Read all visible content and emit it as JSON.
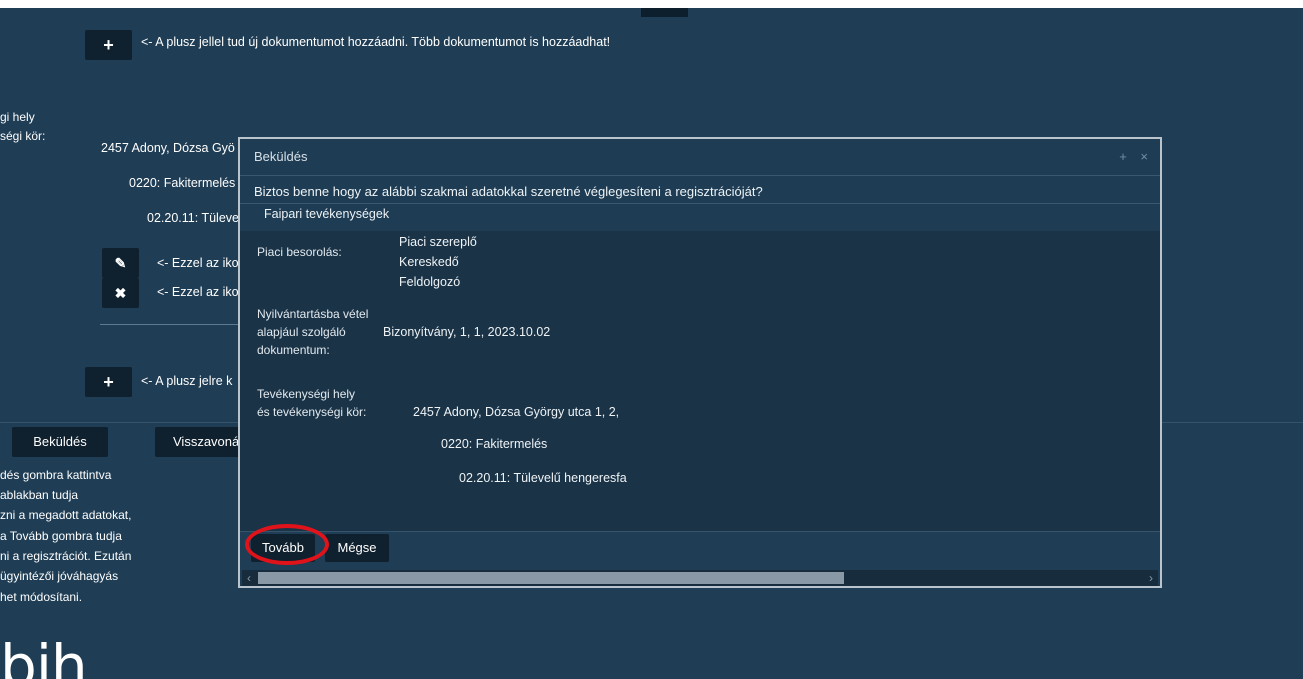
{
  "bg": {
    "add_doc_hint": "<- A plusz jellel tud új dokumentumot hozzáadni. Több dokumentumot is hozzáadhat!",
    "side_label_1": "gi hely",
    "side_label_2": "ségi kör:",
    "address_partial": "2457 Adony, Dózsa Gyö",
    "code1_partial": "0220: Fakitermelés",
    "code2_partial": "02.20.11: Tüleve",
    "edit_hint_partial": "<- Ezzel az iko",
    "delete_hint_partial": "<- Ezzel az iko",
    "add_partial": "<- A plusz jelre k",
    "submit_button": "Beküldés",
    "revoke_button_partial": "Visszavonás",
    "help_lines": [
      "dés gombra kattintva",
      "ablakban tudja",
      "zni a megadott adatokat,",
      "a Tovább gombra tudja",
      "ni a regisztrációt. Ezután",
      " ügyintézői jóváhagyás",
      "het módosítani."
    ],
    "logo_text": "bih"
  },
  "dialog": {
    "title": "Beküldés",
    "ctrl_expand": "+",
    "ctrl_close": "×",
    "question": "Biztos benne hogy az alábbi szakmai adatokkal szeretné véglegesíteni a regisztrációját?",
    "section": "Faipari tevékenységek",
    "market_label": "Piaci besorolás:",
    "market_values": [
      "Piaci szereplő",
      "Kereskedő",
      "Feldolgozó"
    ],
    "doc_label_lines": [
      "Nyilvántartásba vétel",
      "alapjául szolgáló",
      "dokumentum:"
    ],
    "doc_value": "Bizonyítvány, 1, 1, 2023.10.02",
    "site_label_lines": [
      "Tevékenységi hely",
      "és tevékenységi kör:"
    ],
    "site_address": "2457 Adony, Dózsa György utca 1, 2,",
    "site_code1": "0220: Fakitermelés",
    "site_code2": "02.20.11: Tülevelű hengeresfa",
    "next_button": "Tovább",
    "cancel_button": "Mégse"
  }
}
